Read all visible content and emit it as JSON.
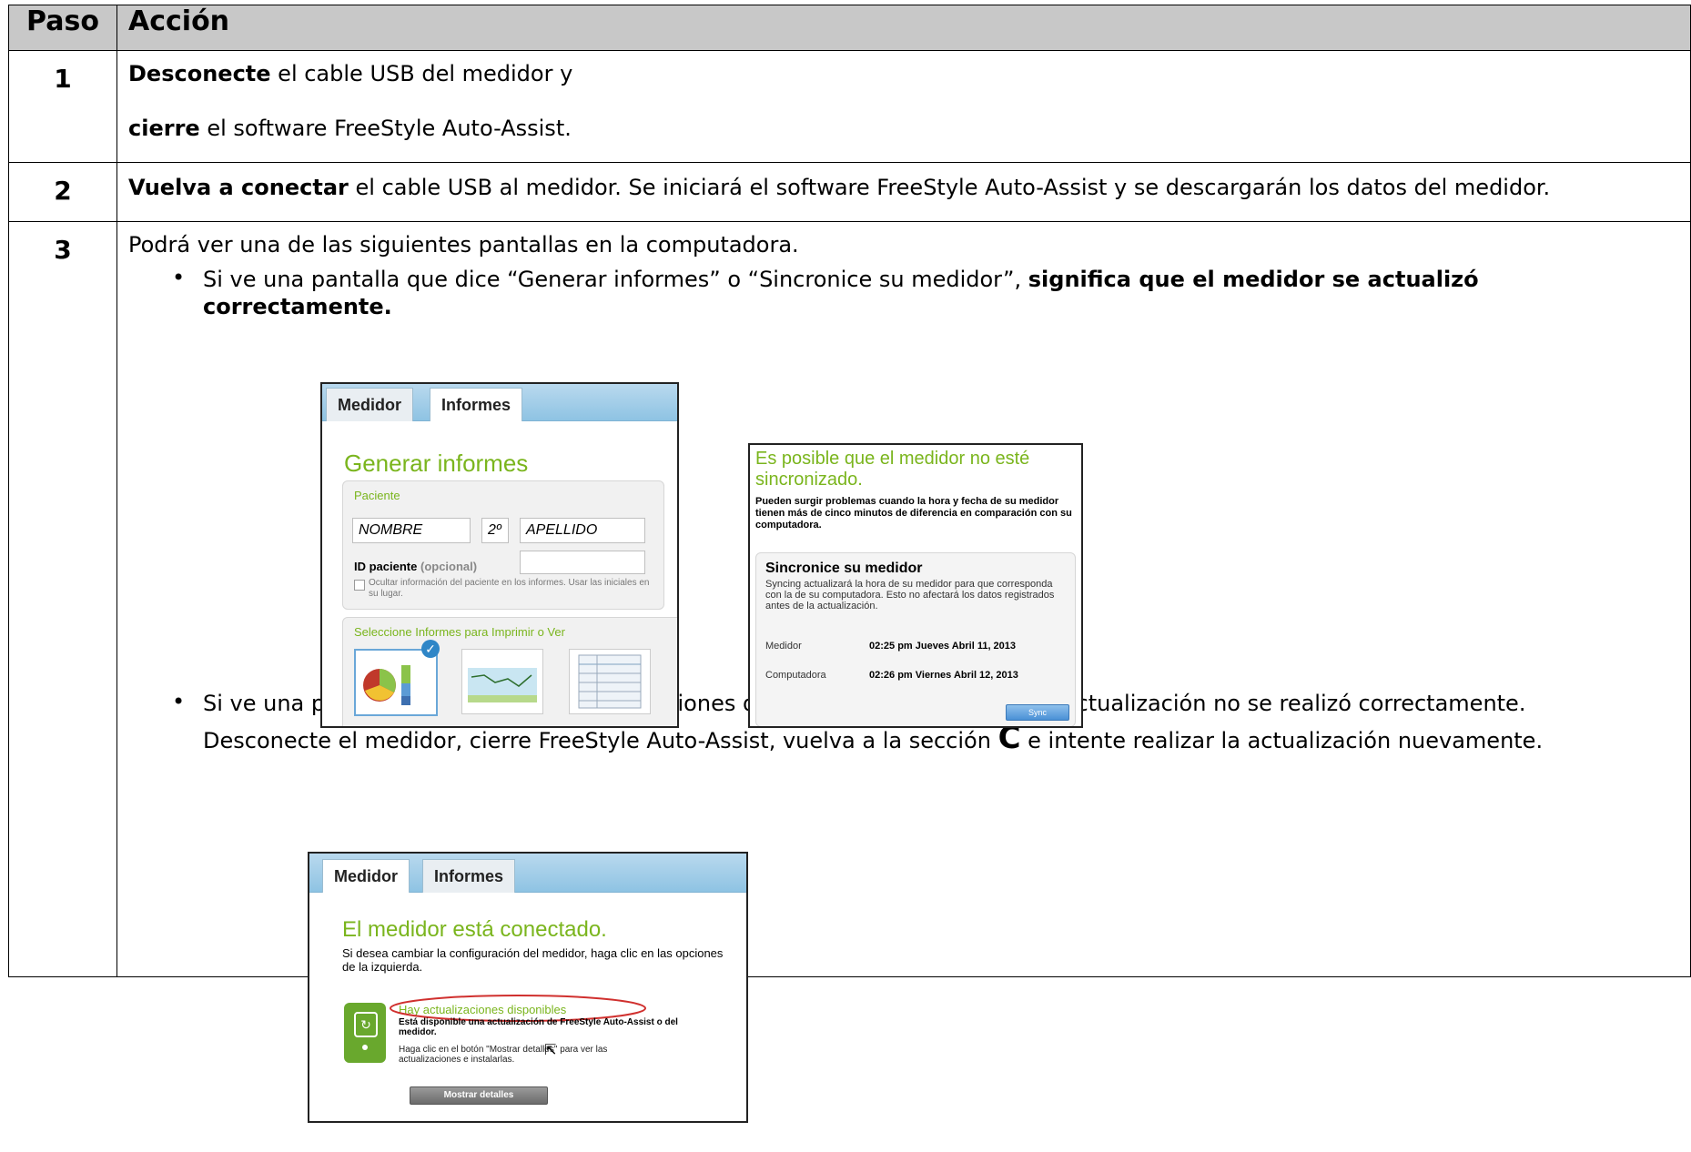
{
  "table": {
    "header_step": "Paso",
    "header_action": "Acción"
  },
  "steps": [
    {
      "num": "1",
      "line1_bold": "Desconecte",
      "line1_rest": " el cable USB del medidor y",
      "line2_bold": "cierre",
      "line2_rest": " el software FreeStyle Auto-Assist."
    },
    {
      "num": "2",
      "bold": "Vuelva a conectar",
      "rest": " el cable USB al medidor. Se iniciará el software FreeStyle Auto-Assist y se descargarán los datos del medidor."
    },
    {
      "num": "3",
      "intro": "Podrá ver una de las siguientes pantallas en la computadora.",
      "bullet1_text": "Si ve una pantalla que dice “Generar informes” o “Sincronice su medidor”, ",
      "bullet1_bold": "significa que el medidor se actualizó correctamente.",
      "bullet2_line1": "Si ve una pantalla que dice “Hay actualizaciones disponibles”, significa que la actualización no se realizó correctamente.",
      "bullet2_line2_a": "Desconecte el medidor, cierre FreeStyle Auto-Assist, vuelva a la sección ",
      "bullet2_section": "C",
      "bullet2_line2_b": " e intente realizar la actualización nuevamente."
    }
  ],
  "shot1": {
    "tab_meter": "Medidor",
    "tab_reports": "Informes",
    "title": "Generar informes",
    "patient_label": "Paciente",
    "first_name": "NOMBRE",
    "middle": "2º",
    "last_name": "APELLIDO",
    "id_label": "ID paciente",
    "id_optional": "(opcional)",
    "hide_info": "Ocultar información del paciente en los informes. Usar las iniciales en su lugar.",
    "select_reports": "Seleccione Informes para Imprimir o Ver"
  },
  "shot2": {
    "title": "Es posible que el medidor no esté sincronizado.",
    "warning": "Pueden surgir problemas cuando la hora y fecha de su medidor tienen más de cinco minutos de diferencia en comparación con su computadora.",
    "sync_heading": "Sincronice su medidor",
    "sync_desc": "Syncing actualizará la hora de su medidor para que corresponda con la de su computadora.  Esto no afectará los datos registrados antes de la actualización.",
    "meter_label": "Medidor",
    "meter_time": "02:25 pm Jueves Abril 11, 2013",
    "computer_label": "Computadora",
    "computer_time": "02:26 pm Viernes Abril 12, 2013",
    "sync_button": "Sync"
  },
  "shot3": {
    "tab_meter": "Medidor",
    "tab_reports": "Informes",
    "title": "El medidor está conectado.",
    "subtitle": "Si desea cambiar la configuración del medidor, haga clic en las opciones de la izquierda.",
    "updates_heading": "Hay actualizaciones disponibles",
    "updates_desc": "Está disponible una actualización de FreeStyle Auto-Assist o del medidor.",
    "updates_hint": "Haga clic en el botón \"Mostrar detalles\" para ver las actualizaciones e instalarlas.",
    "details_button": "Mostrar detalles"
  },
  "colors": {
    "header_bg": "#c8c8c8",
    "green": "#7ab51d",
    "red_ellipse": "#d0302e",
    "blue_check": "#2f86c7"
  }
}
